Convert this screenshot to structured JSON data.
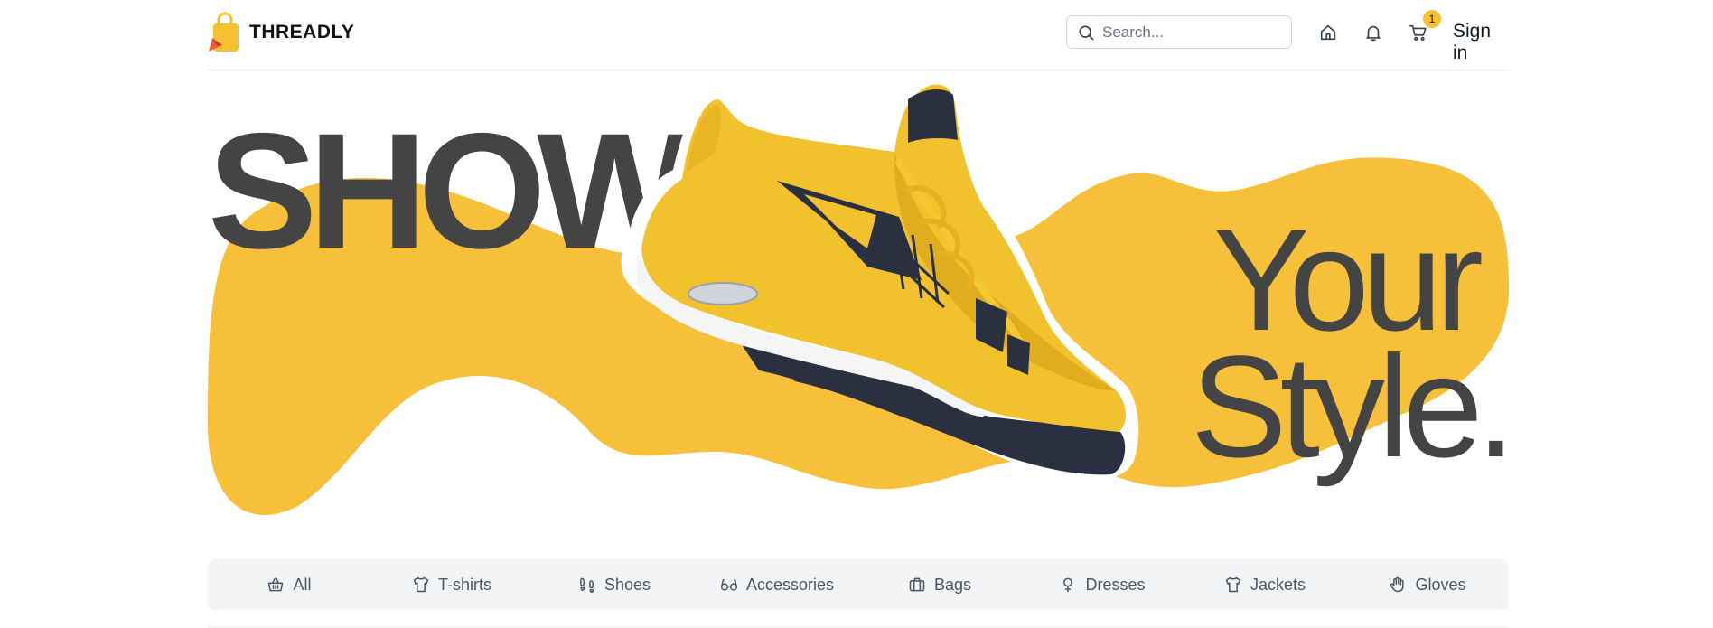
{
  "brand": {
    "name": "THREADLY",
    "logo_icon": "shopping-bag-icon",
    "colors": {
      "bag": "#f6c033",
      "arrow": "#ef5a3a"
    }
  },
  "header": {
    "search": {
      "placeholder": "Search...",
      "value": "",
      "icon": "search-icon"
    },
    "icons": [
      "home-icon",
      "bell-icon",
      "cart-icon"
    ],
    "cart_count": "1",
    "signin_label": "Sign in"
  },
  "hero": {
    "word_1": "SHOW",
    "word_2": "Your",
    "word_3": "Style.",
    "image": "yellow-sneaker",
    "colors": {
      "blob": "#f7c03a",
      "text": "#444444",
      "shoe": "#f2c12e",
      "sole": "#2b3040"
    }
  },
  "categories": [
    {
      "label": "All",
      "icon": "basket-icon"
    },
    {
      "label": "T-shirts",
      "icon": "tshirt-icon"
    },
    {
      "label": "Shoes",
      "icon": "footprints-icon"
    },
    {
      "label": "Accessories",
      "icon": "glasses-icon"
    },
    {
      "label": "Bags",
      "icon": "briefcase-icon"
    },
    {
      "label": "Dresses",
      "icon": "dress-icon"
    },
    {
      "label": "Jackets",
      "icon": "jacket-icon"
    },
    {
      "label": "Gloves",
      "icon": "glove-icon"
    }
  ]
}
